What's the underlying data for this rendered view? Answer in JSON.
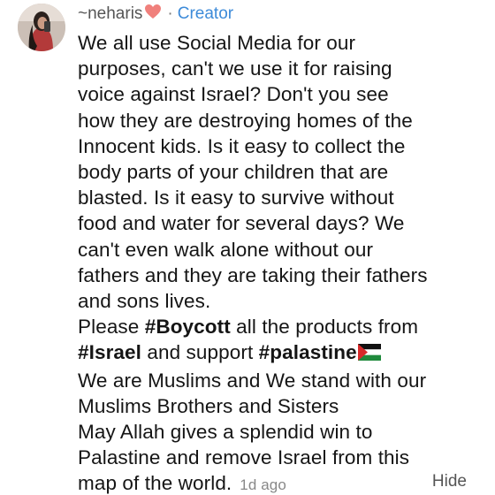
{
  "comment": {
    "username": "~neharis",
    "heart_emoji": "heart-icon",
    "separator": "·",
    "role": "Creator",
    "avatar_icon": "avatar-icon",
    "lines": [
      "We all use Social Media for our",
      "purposes, can't we use it for raising",
      "voice against Israel? Don't you see",
      "how they are destroying homes of the",
      "Innocent kids. Is it easy to collect the",
      "body parts of your children that are",
      "blasted. Is it easy to survive without",
      "food and water for several days? We",
      "can't even walk alone without our",
      "fathers and they are taking their fathers",
      "and sons lives."
    ],
    "boycott_line": {
      "before": "Please ",
      "tag": "#Boycott",
      "after": " all the products from"
    },
    "israel_line": {
      "tag1": "#Israel",
      "middle": " and support ",
      "tag2": "#palastine",
      "flag_emoji": "palestine-flag-icon"
    },
    "closing_lines": [
      "We are Muslims and We stand with our",
      "Muslims Brothers and Sisters",
      "May Allah gives a splendid win to",
      "Palastine and remove Israel from this"
    ],
    "final_line": "map of the world.",
    "timestamp": "1d ago",
    "hide_label": "Hide"
  },
  "colors": {
    "creator": "#3d8bd9",
    "heart": "#f0807c",
    "text": "#151515",
    "muted": "#888888"
  }
}
